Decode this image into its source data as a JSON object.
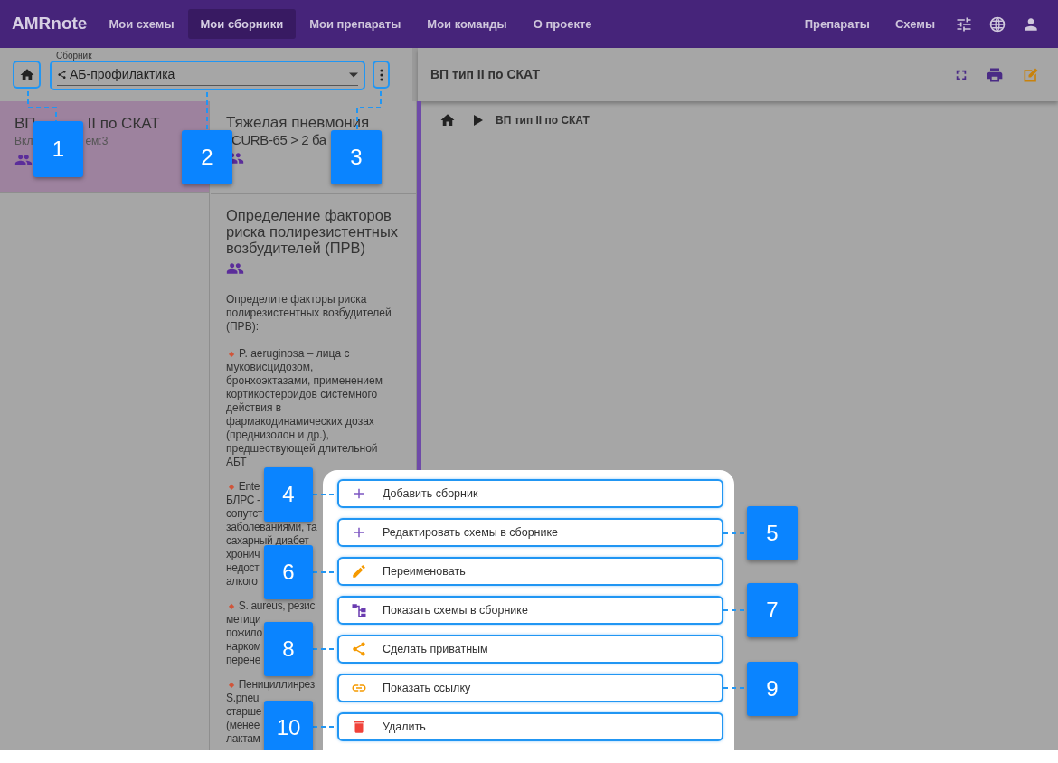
{
  "nav": {
    "logo": "AMRnote",
    "items": [
      {
        "label": "Мои схемы",
        "selected": false
      },
      {
        "label": "Мои сборники",
        "selected": true
      },
      {
        "label": "Мои препараты",
        "selected": false
      },
      {
        "label": "Мои команды",
        "selected": false
      },
      {
        "label": "О проекте",
        "selected": false
      }
    ],
    "right_items": [
      "Препараты",
      "Схемы"
    ]
  },
  "toolbar": {
    "select": {
      "label": "Сборник",
      "value": "АБ-профилактика"
    },
    "title": "ВП тип II по СКАТ"
  },
  "collections": [
    {
      "title": [
        "ВП",
        "II по СКАТ"
      ],
      "subtitle": [
        "Вкл",
        "ем:3"
      ],
      "selected": true
    }
  ],
  "schemes": [
    {
      "title_lines": [
        "Тяжелая пневмония",
        "CURB-65 > 2 ба"
      ]
    },
    {
      "title": "Определение факторов риска полирезистентных возбудителей (ПРВ)",
      "intro": "Определите факторы риска полирезистентных возбудителей (ПРВ):",
      "bullet": "◆",
      "bullets": [
        {
          "kind": "text",
          "text": "P. aeruginosa – лица с муковисцидозом, бронхоэктазами, применением кортикостероидов системного действия в фармакодинамических дозах (преднизолон и др.), предшествующей длительной АБТ"
        },
        {
          "kind": "covered",
          "lines": [
            "Ente",
            "БЛРС -",
            "сопутст",
            "заболеваниями, та",
            "сахарный диабет",
            "хронич",
            "недост",
            "алкого"
          ]
        },
        {
          "kind": "covered",
          "lines": [
            "S. aureus, резис",
            "метици",
            "пожило",
            "нарком",
            "перене"
          ]
        },
        {
          "kind": "covered",
          "lines": [
            "Пенициллинрез",
            "S.pneu",
            "старше",
            "(менее",
            "лактам"
          ]
        }
      ]
    }
  ],
  "breadcrumb": {
    "current": "ВП тип II по СКАТ"
  },
  "menu": {
    "items": [
      {
        "kind": "plus",
        "label": "Добавить сборник"
      },
      {
        "kind": "plus",
        "label": "Редактировать схемы в сборнике"
      },
      {
        "kind": "pencil",
        "label": "Переименовать"
      },
      {
        "kind": "tree",
        "label": "Показать схемы в сборнике"
      },
      {
        "kind": "share",
        "label": "Сделать приватным"
      },
      {
        "kind": "link",
        "label": "Показать ссылку"
      },
      {
        "kind": "trash",
        "label": "Удалить"
      }
    ]
  },
  "callouts": [
    "1",
    "2",
    "3",
    "4",
    "5",
    "6",
    "7",
    "8",
    "9",
    "10"
  ]
}
